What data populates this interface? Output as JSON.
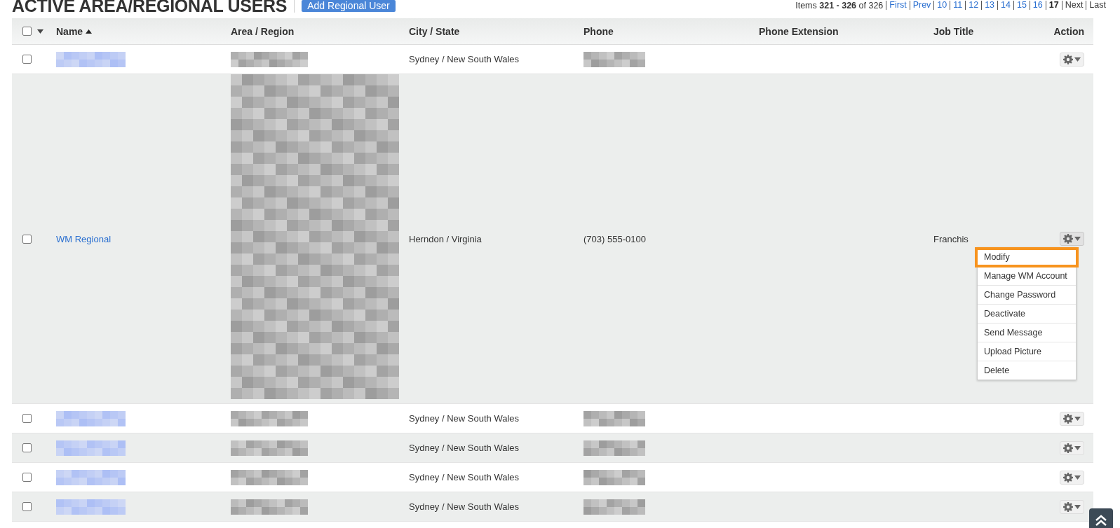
{
  "title": "ACTIVE AREA/REGIONAL USERS",
  "add_button": "Add Regional User",
  "pagination": {
    "summary": "Items **321 - 326** of 326",
    "pages": [
      {
        "label": "First",
        "kind": "link"
      },
      {
        "label": "Prev",
        "kind": "link"
      },
      {
        "label": "10",
        "kind": "link"
      },
      {
        "label": "11",
        "kind": "link"
      },
      {
        "label": "12",
        "kind": "link"
      },
      {
        "label": "13",
        "kind": "link"
      },
      {
        "label": "14",
        "kind": "link"
      },
      {
        "label": "15",
        "kind": "link"
      },
      {
        "label": "16",
        "kind": "link"
      },
      {
        "label": "17",
        "kind": "current"
      },
      {
        "label": "Next",
        "kind": "plain"
      },
      {
        "label": "Last",
        "kind": "plain"
      }
    ]
  },
  "table": {
    "select_all": {
      "checked": false
    },
    "columns": [
      {
        "label": "Name",
        "sorted": true
      },
      {
        "label": "Area / Region",
        "sorted": false
      },
      {
        "label": "City /  State",
        "sorted": false
      },
      {
        "label": "Phone",
        "sorted": false
      },
      {
        "label": "Phone Extension",
        "sorted": false
      },
      {
        "label": "Job Title",
        "sorted": false
      },
      {
        "label": "Action",
        "sorted": false
      }
    ],
    "rows": [
      {
        "checked": false,
        "name": {
          "kind": "redacted"
        },
        "area": {
          "kind": "redacted"
        },
        "city_state": "Sydney / New South Wales",
        "phone": {
          "kind": "redacted"
        },
        "menu_open": false
      },
      {
        "checked": false,
        "name": {
          "kind": "link",
          "text": "WM Regional"
        },
        "area": {
          "kind": "redacted_tall"
        },
        "city_state": "Herndon / Virginia",
        "phone": {
          "kind": "text",
          "text": "(703) 555-0100"
        },
        "job_title": "Franchis",
        "menu_open": true
      },
      {
        "checked": false,
        "name": {
          "kind": "redacted"
        },
        "area": {
          "kind": "redacted"
        },
        "city_state": "Sydney / New South Wales",
        "phone": {
          "kind": "redacted"
        },
        "menu_open": false
      },
      {
        "checked": false,
        "name": {
          "kind": "redacted"
        },
        "area": {
          "kind": "redacted"
        },
        "city_state": "Sydney / New South Wales",
        "phone": {
          "kind": "redacted"
        },
        "menu_open": false
      },
      {
        "checked": false,
        "name": {
          "kind": "redacted"
        },
        "area": {
          "kind": "redacted"
        },
        "city_state": "Sydney / New South Wales",
        "phone": {
          "kind": "redacted"
        },
        "menu_open": false
      },
      {
        "checked": false,
        "name": {
          "kind": "redacted"
        },
        "area": {
          "kind": "redacted"
        },
        "city_state": "Sydney / New South Wales",
        "phone": {
          "kind": "redacted"
        },
        "menu_open": false
      }
    ]
  },
  "action_menu": [
    {
      "label": "Modify",
      "selected": true
    },
    {
      "label": "Manage WM Account",
      "selected": false
    },
    {
      "label": "Change Password",
      "selected": false
    },
    {
      "label": "Deactivate",
      "selected": false
    },
    {
      "label": "Send Message",
      "selected": false
    },
    {
      "label": "Upload Picture",
      "selected": false
    },
    {
      "label": "Delete",
      "selected": false
    }
  ]
}
